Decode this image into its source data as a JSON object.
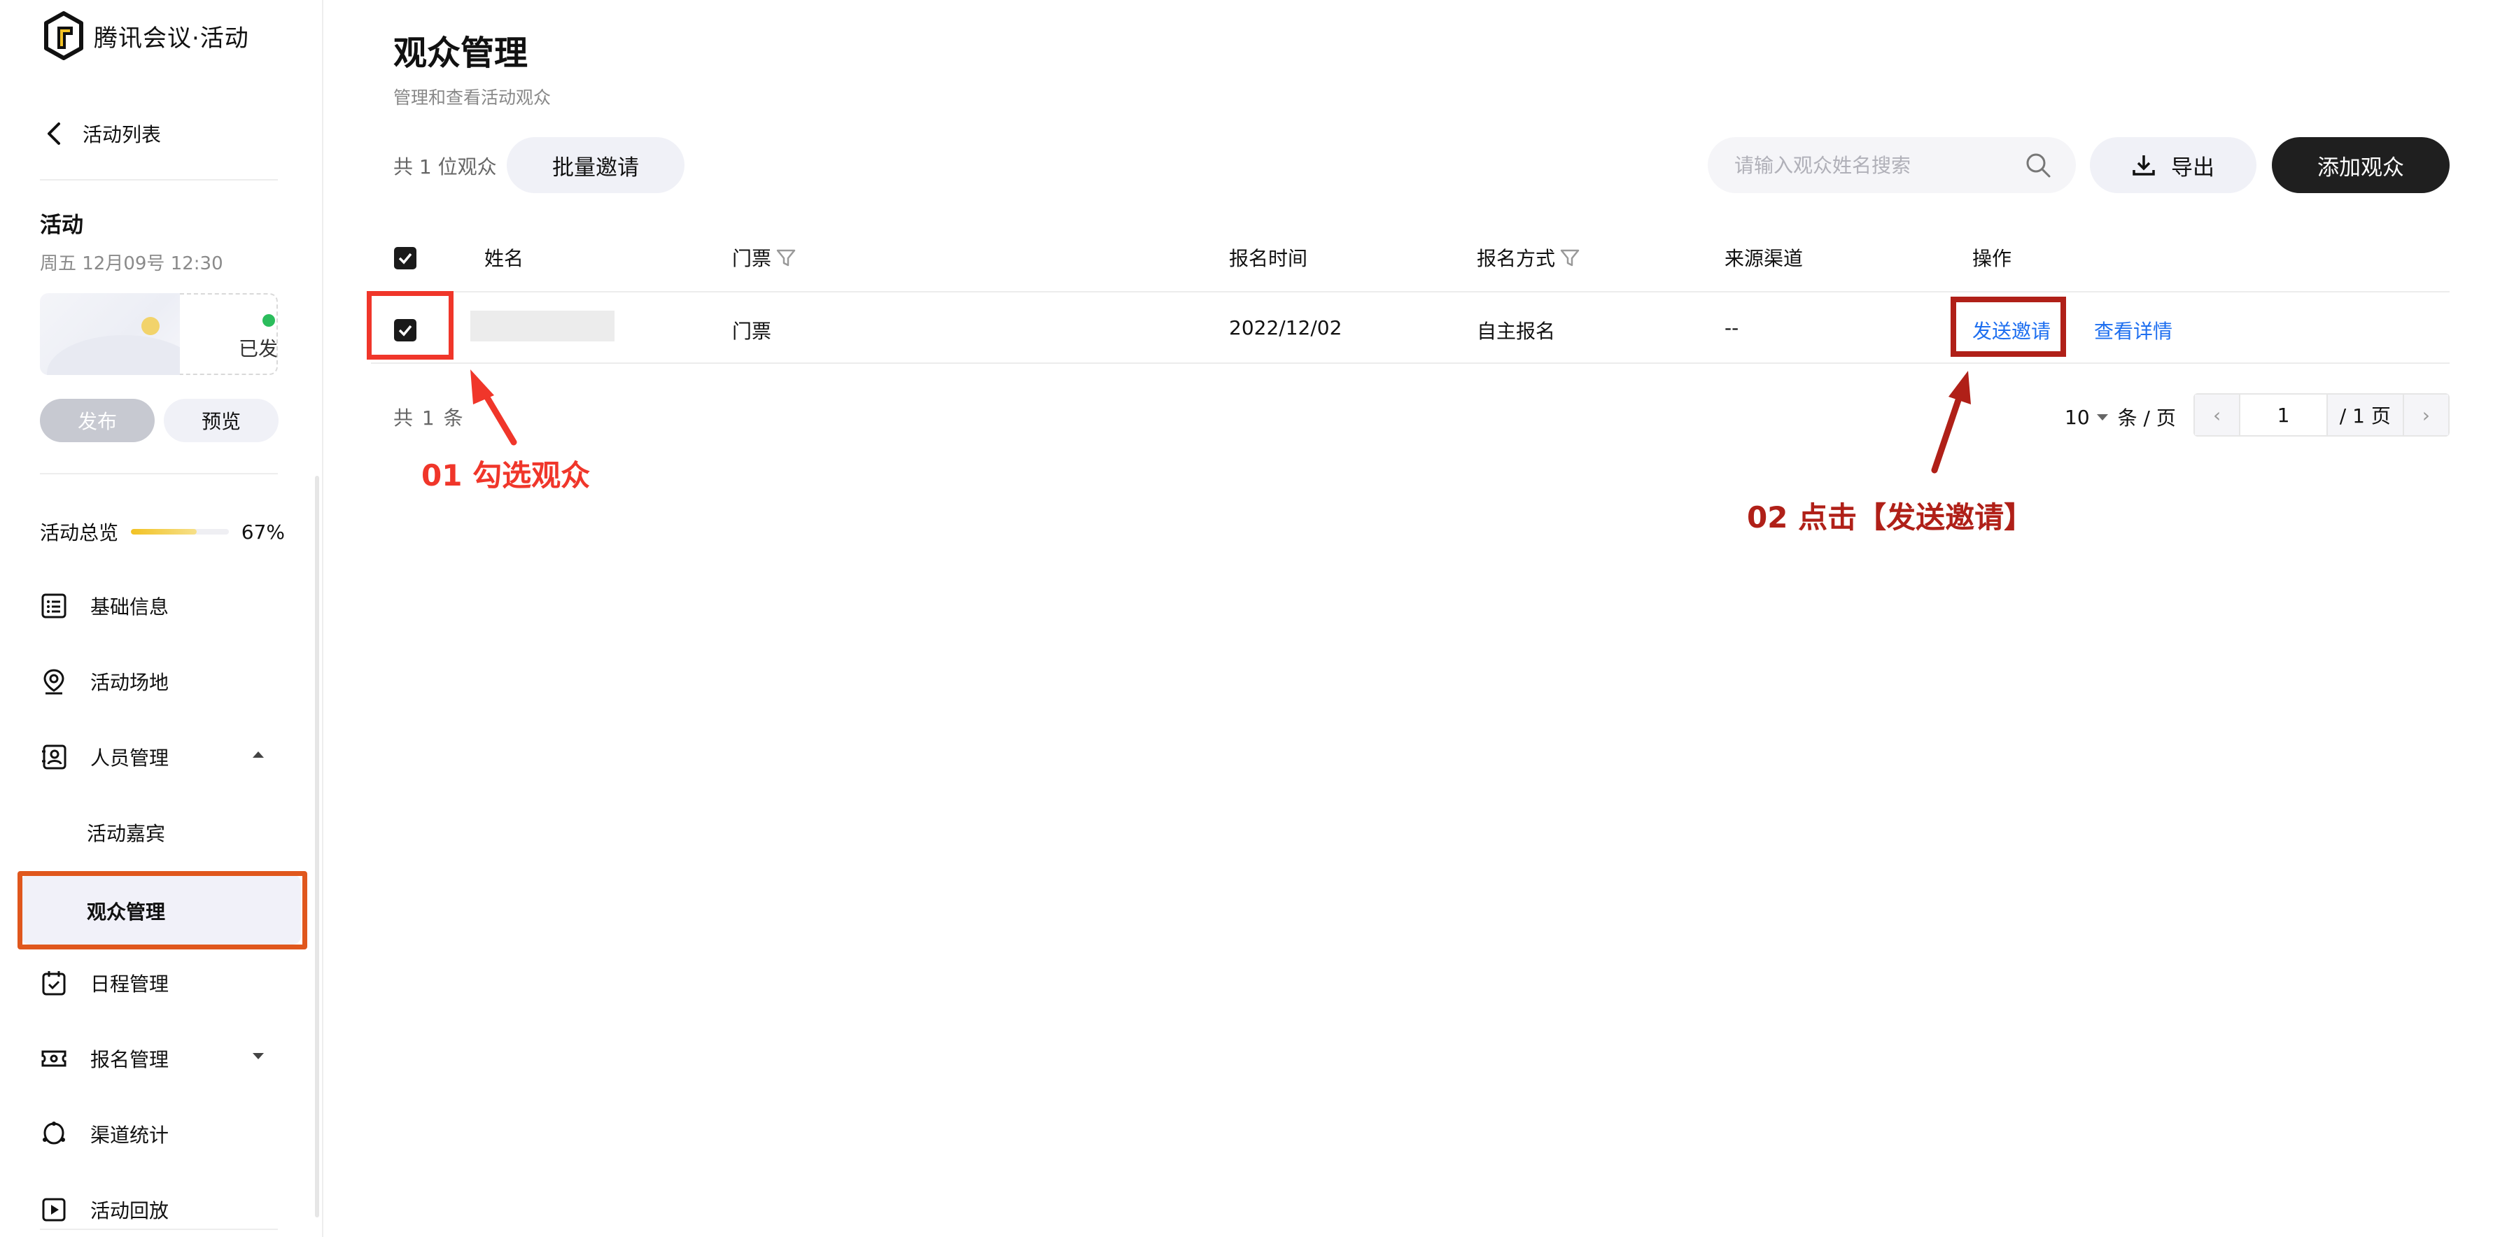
{
  "app": {
    "logo_text": "腾讯会议·活动"
  },
  "sidebar": {
    "back_label": "活动列表",
    "event": {
      "title": "活动",
      "time": "周五  12月09号  12:30",
      "status": "已发布",
      "status_color": "#2bbd5c"
    },
    "publish_label": "发布",
    "preview_label": "预览",
    "progress": {
      "label": "活动总览",
      "value_text": "67%",
      "value": 0.67
    },
    "nav": [
      {
        "label": "基础信息",
        "icon": "list-icon"
      },
      {
        "label": "活动场地",
        "icon": "location-pin-icon"
      },
      {
        "label": "人员管理",
        "icon": "contact-card-icon",
        "expanded": true
      },
      {
        "label": "日程管理",
        "icon": "calendar-check-icon"
      },
      {
        "label": "报名管理",
        "icon": "ticket-icon",
        "expanded": false
      },
      {
        "label": "渠道统计",
        "icon": "channel-icon"
      },
      {
        "label": "活动回放",
        "icon": "play-icon"
      }
    ],
    "sub_items": [
      {
        "label": "活动嘉宾"
      },
      {
        "label": "观众管理",
        "active": true
      }
    ]
  },
  "main": {
    "title": "观众管理",
    "subtitle": "管理和查看活动观众",
    "count_label": "共 1 位观众",
    "batch_invite_label": "批量邀请",
    "search": {
      "placeholder": "请输入观众姓名搜索",
      "value": ""
    },
    "export_label": "导出",
    "add_label": "添加观众",
    "table": {
      "columns": [
        "姓名",
        "门票",
        "报名时间",
        "报名方式",
        "来源渠道",
        "操作"
      ],
      "rows": [
        {
          "name": "",
          "ticket": "门票",
          "time": "2022/12/02",
          "method": "自主报名",
          "channel": "--",
          "actions": [
            "发送邀请",
            "查看详情"
          ],
          "checked": true
        }
      ]
    },
    "pagination": {
      "total_label": "共 1 条",
      "page_size": "10",
      "page_size_unit": "条 / 页",
      "prev": "‹",
      "current_page": "1",
      "total_pages": "/ 1 页",
      "next": "›"
    }
  },
  "annotations": {
    "step1": "01 勾选观众",
    "step2": "02 点击【发送邀请】",
    "step1_color": "#f0362a",
    "step2_color": "#b02018",
    "sidebar_highlight_color": "#e0571d"
  },
  "colors": {
    "primary_dark": "#1f1f1f",
    "link": "#1e6ff0",
    "accent_yellow": "#f2c224"
  }
}
